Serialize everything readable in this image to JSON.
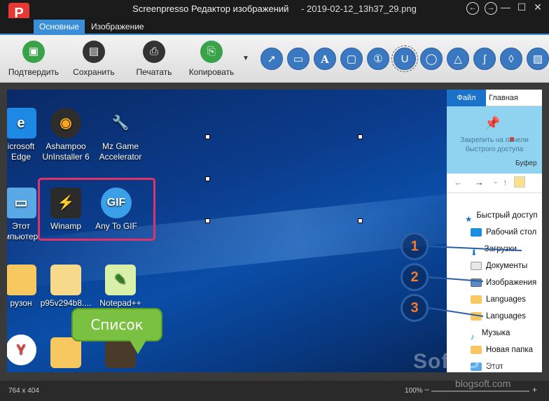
{
  "app": {
    "title": "Screenpresso Редактор изображений",
    "filename": "2019-02-12_13h37_29.png"
  },
  "tabs": [
    {
      "label": "Основные",
      "active": true
    },
    {
      "label": "Изображение",
      "active": false
    }
  ],
  "toolbar": {
    "validate": "Подтвердить",
    "save": "Сохранить",
    "print": "Печатать",
    "copy": "Копировать"
  },
  "desktop_icons": [
    {
      "label": "icrosoft\nEdge"
    },
    {
      "label": "Ashampoo\nUnInstaller 6"
    },
    {
      "label": "Mz Game\nAccelerator"
    },
    {
      "label": "Этот\nмпьютер"
    },
    {
      "label": "Winamp"
    },
    {
      "label": "Any To GIF"
    },
    {
      "label": "рузон"
    },
    {
      "label": "p95v294b8...."
    },
    {
      "label": "Notepad++"
    }
  ],
  "bubble": {
    "text": "Список"
  },
  "explorer": {
    "tab_file": "Файл",
    "tab_home": "Главная",
    "pin_text": "Закрепить на панели быстрого доступа",
    "buffer": "Буфер",
    "items": [
      "Быстрый доступ",
      "Рабочий стол",
      "Загрузки",
      "Документы",
      "Изображения",
      "Languages",
      "Languages",
      "Музыка",
      "Новая папка",
      "Этот компьютер"
    ]
  },
  "callouts": [
    "1",
    "2",
    "3"
  ],
  "status": {
    "dims": "764 x 404",
    "zoom": "100%"
  },
  "watermark": {
    "main": "Soft-Blog",
    "sub": "blogsoft.com"
  },
  "colors": {
    "accent": "#3b8ed8",
    "selection": "#e0336a",
    "bubble": "#7ac142",
    "callout_text": "#f07b2f"
  }
}
